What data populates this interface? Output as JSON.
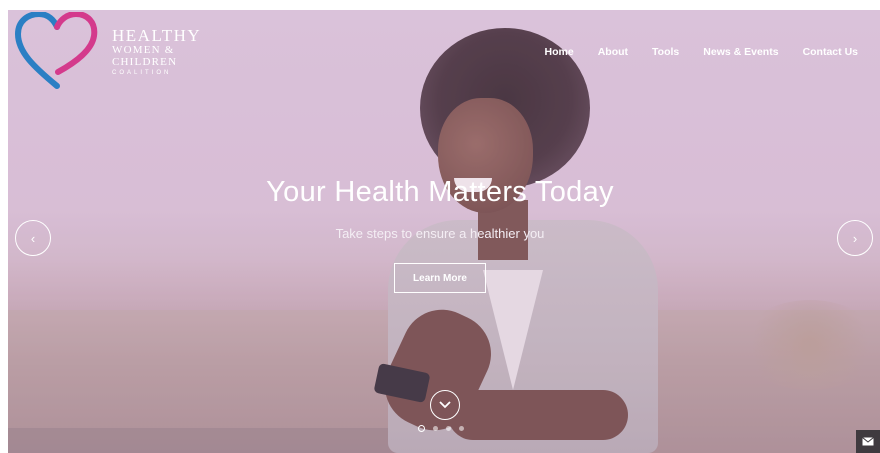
{
  "logo": {
    "line1": "HEALTHY",
    "line2": "WOMEN &",
    "line3": "CHILDREN",
    "line4": "COALITION",
    "heart_colors": [
      "#2b7fc4",
      "#d43a8c"
    ]
  },
  "nav": {
    "items": [
      {
        "label": "Home"
      },
      {
        "label": "About"
      },
      {
        "label": "Tools"
      },
      {
        "label": "News & Events"
      },
      {
        "label": "Contact Us"
      }
    ]
  },
  "hero": {
    "headline": "Your Health Matters Today",
    "subtext": "Take steps to ensure a healthier you",
    "button_label": "Learn More",
    "prev_arrow_icon": "chevron-left-icon",
    "next_arrow_icon": "chevron-right-icon",
    "prev_glyph": "‹",
    "next_glyph": "›",
    "scroll_icon": "chevron-down-icon",
    "slide_count": 4,
    "active_slide": 1
  },
  "mail_icon": "envelope-icon"
}
